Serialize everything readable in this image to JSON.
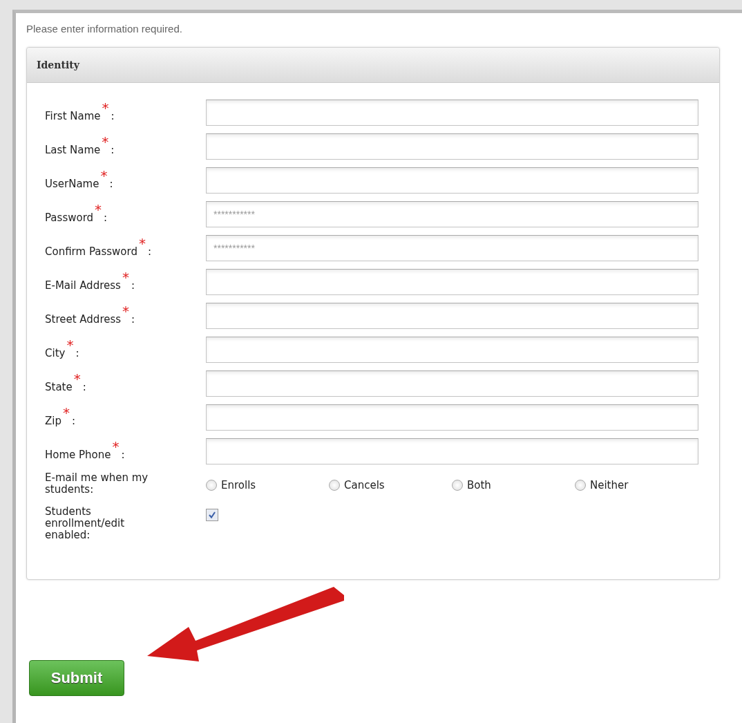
{
  "intro": "Please enter information required.",
  "panel": {
    "title": "Identity",
    "rows": [
      {
        "kind": "text",
        "label": "First Name",
        "required": true
      },
      {
        "kind": "text",
        "label": "Last Name",
        "required": true
      },
      {
        "kind": "text",
        "label": "UserName",
        "required": true
      },
      {
        "kind": "password",
        "label": "Password",
        "required": true,
        "placeholder": "***********"
      },
      {
        "kind": "password",
        "label": "Confirm Password",
        "required": true,
        "placeholder": "***********"
      },
      {
        "kind": "text",
        "label": "E-Mail Address",
        "required": true
      },
      {
        "kind": "text",
        "label": "Street Address",
        "required": true
      },
      {
        "kind": "text",
        "label": "City",
        "required": true
      },
      {
        "kind": "text",
        "label": "State",
        "required": true
      },
      {
        "kind": "text",
        "label": "Zip",
        "required": true
      },
      {
        "kind": "text",
        "label": "Home Phone",
        "required": true
      },
      {
        "kind": "radio",
        "label": "E-mail me when my students:",
        "options": [
          {
            "label": "Enrolls",
            "selected": false
          },
          {
            "label": "Cancels",
            "selected": false
          },
          {
            "label": "Both",
            "selected": false
          },
          {
            "label": "Neither",
            "selected": false
          }
        ]
      },
      {
        "kind": "checkbox",
        "label": "Students enrollment/edit enabled:",
        "checked": true
      }
    ],
    "colon": ":",
    "mark": "*"
  },
  "submit": "Submit"
}
